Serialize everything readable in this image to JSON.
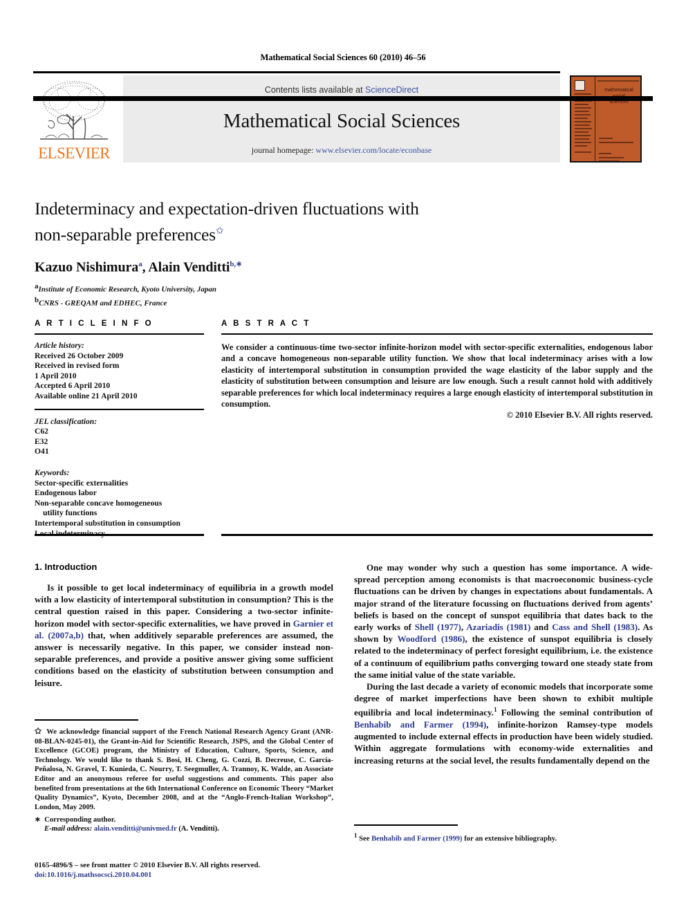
{
  "running_head": "Mathematical Social Sciences 60 (2010) 46–56",
  "masthead": {
    "contents_prefix": "Contents lists available at ",
    "sciencedirect": "ScienceDirect",
    "journal_title": "Mathematical Social Sciences",
    "homepage_prefix": "journal homepage: ",
    "homepage_url": "www.elsevier.com/locate/econbase",
    "publisher_logo_text": "ELSEVIER",
    "cover_title_line1": "mathematical",
    "cover_title_line2": "social",
    "cover_title_line3": "sciences",
    "link_color": "#4054A0",
    "elsevier_orange": "#E87722",
    "cover_background": "#BF5A2B"
  },
  "title_block": {
    "title_line1": "Indeterminacy and expectation-driven fluctuations with",
    "title_line2": "non-separable preferences",
    "title_footnote_mark": "✩",
    "authors": "Kazuo Nishimura",
    "author1_sup": "a",
    "authors_mid": ", Alain Venditti",
    "author2_sup": "b,",
    "author2_star": "∗",
    "affiliation_a_mark": "a",
    "affiliation_a": "Institute of Economic Research, Kyoto University, Japan",
    "affiliation_b_mark": "b",
    "affiliation_b": "CNRS - GREQAM and EDHEC, France"
  },
  "article_info": {
    "heading": "A R T I C L E   I N F O",
    "history_label": "Article history:",
    "history": [
      "Received 26 October 2009",
      "Received in revised form",
      "1 April 2010",
      "Accepted 6 April 2010",
      "Available online 21 April 2010"
    ],
    "jel_label": "JEL classification:",
    "jel_codes": [
      "C62",
      "E32",
      "O41"
    ],
    "keywords_label": "Keywords:",
    "keywords": [
      "Sector-specific externalities",
      "Endogenous labor",
      "Non-separable concave homogeneous",
      "utility functions",
      "Intertemporal substitution in consumption",
      "Local indeterminacy"
    ]
  },
  "abstract": {
    "heading": "A B S T R A C T",
    "text": "We consider a continuous-time two-sector infinite-horizon model with sector-specific externalities, endogenous labor and a concave homogeneous non-separable utility function. We show that local indeterminacy arises with a low elasticity of intertemporal substitution in consumption provided the wage elasticity of the labor supply and the elasticity of substitution between consumption and leisure are low enough. Such a result cannot hold with additively separable preferences for which local indeterminacy requires a large enough elasticity of intertemporal substitution in consumption.",
    "copyright": "© 2010 Elsevier B.V. All rights reserved."
  },
  "body": {
    "section_title": "1. Introduction",
    "left_p1_a": "Is it possible to get local indeterminacy of equilibria in a growth model with a low elasticity of intertemporal substitution in consumption? This is the central question raised in this paper. Considering a two-sector infinite-horizon model with sector-specific externalities, we have proved in ",
    "left_p1_cite": "Garnier et al. (2007a,b)",
    "left_p1_b": " that, when additively separable preferences are assumed, the answer is necessarily negative. In this paper, we consider instead non-separable preferences, and provide a positive answer giving some sufficient conditions based on the elasticity of substitution between consumption and leisure.",
    "right_p1_a": "One may wonder why such a question has some importance. A wide-spread perception among economists is that macroeconomic business-cycle fluctuations can be driven by changes in expectations about fundamentals. A major strand of the literature focussing on fluctuations derived from agents’ beliefs is based on the concept of sunspot equilibria that dates back to the early works of ",
    "right_p1_c1": "Shell (1977)",
    "right_p1_b": ", ",
    "right_p1_c2": "Azariadis (1981)",
    "right_p1_c": " and ",
    "right_p1_c3": "Cass and Shell (1983)",
    "right_p1_d": ". As shown by ",
    "right_p1_c4": "Woodford (1986)",
    "right_p1_e": ", the existence of sunspot equilibria is closely related to the indeterminacy of perfect foresight equilibrium, i.e. the existence of a continuum of equilibrium paths converging toward one steady state from the same initial value of the state variable.",
    "right_p2_a": "During the last decade a variety of economic models that incorporate some degree of market imperfections have been shown to exhibit multiple equilibria and local indeterminacy.",
    "right_p2_fn": "1",
    "right_p2_b": " Following the seminal contribution of ",
    "right_p2_c1": "Benhabib and Farmer (1994)",
    "right_p2_c": ", infinite-horizon Ramsey-type models augmented to include external effects in production have been widely studied. Within aggregate formulations with economy-wide externalities and increasing returns at the social level, the results fundamentally depend on the"
  },
  "footnotes": {
    "left_star": "✩",
    "left_text": "We acknowledge financial support of the French National Research Agency Grant (ANR-08-BLAN-0245-01), the Grant-in-Aid for Scientific Research, JSPS, and the Global Center of Excellence (GCOE) program, the Ministry of Education, Culture, Sports, Science, and Technology. We would like to thank S. Bosi, H. Cheng, G. Cozzi, B. Decreuse, C. García-Peñalosa, N. Gravel, T. Kunieda, C. Nourry, T. Seegmuller, A. Trannoy, K. Walde, an Associate Editor and an anonymous referee for useful suggestions and comments. This paper also benefited from presentations at the 6th International Conference on Economic Theory “Market Quality Dynamics”, Kyoto, December 2008, and at the “Anglo-French-Italian Workshop”, London, May 2009.",
    "corresponding_star": "∗",
    "corresponding": "Corresponding author.",
    "email_label": "E-mail address:",
    "email_address": "alain.venditti@univmed.fr",
    "email_suffix": " (A. Venditti).",
    "right_fn_mark": "1",
    "right_fn_pre": "See ",
    "right_fn_cite": "Benhabib and Farmer (1999)",
    "right_fn_post": " for an extensive bibliography."
  },
  "issn": {
    "line1": "0165-4896/$ – see front matter © 2010 Elsevier B.V. All rights reserved.",
    "doi": "doi:10.1016/j.mathsocsci.2010.04.001"
  }
}
